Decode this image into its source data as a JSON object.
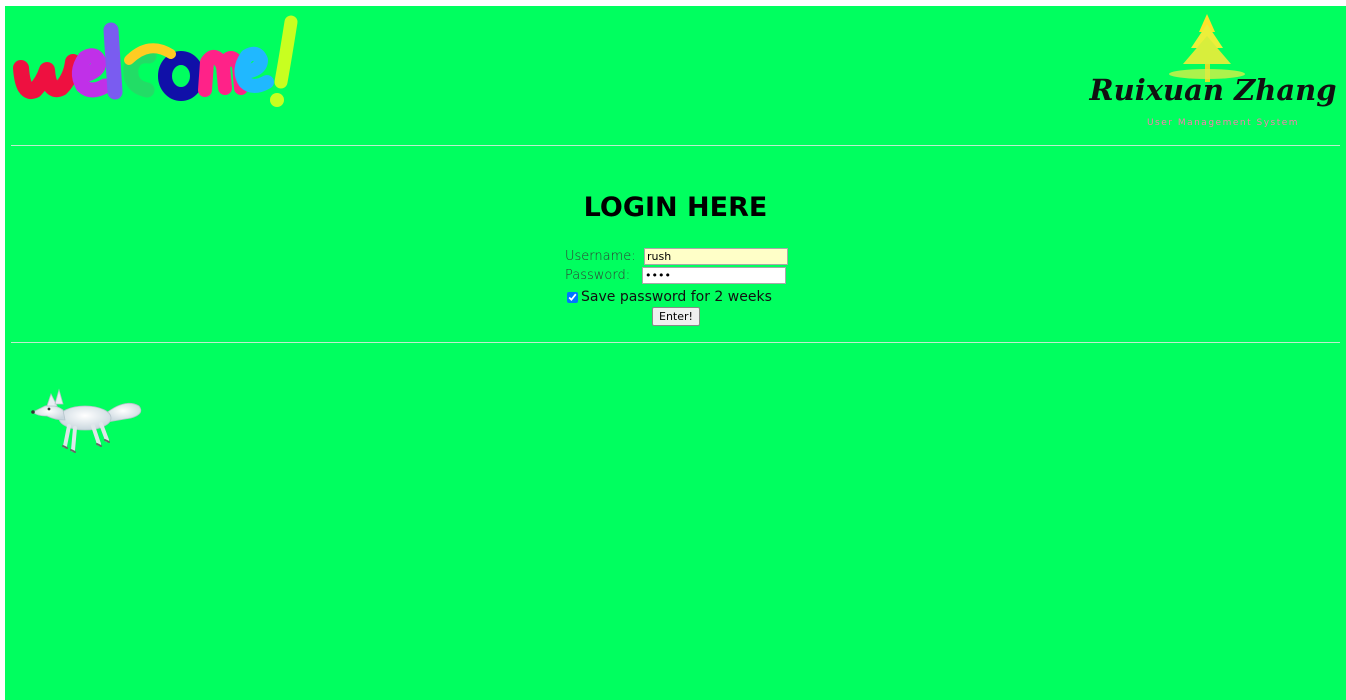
{
  "header": {
    "welcome_logo": "welcome!",
    "brand_name": "Ruixuan Zhang",
    "brand_tagline": "User Management System"
  },
  "login": {
    "title": "LOGIN HERE",
    "username_label": "Username:",
    "username_value": "rush",
    "password_label": "Password:",
    "password_value": "••••",
    "save_password_label": "Save password for 2 weeks",
    "save_password_checked": true,
    "submit_label": "Enter!"
  },
  "decor": {
    "fox_icon": "arctic-fox-icon",
    "tree_icon": "tree-icon"
  },
  "colors": {
    "background": "#00ff5f",
    "username_field_bg": "#ffffc8"
  }
}
